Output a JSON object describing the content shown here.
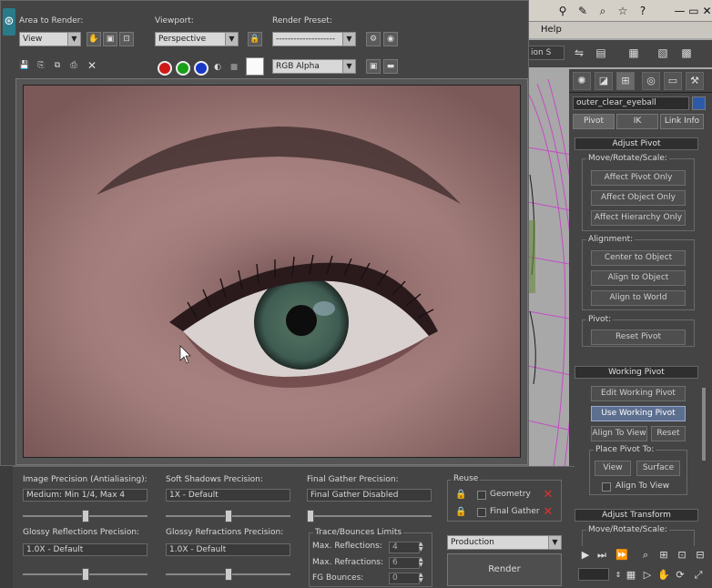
{
  "menu": {
    "help": "Help"
  },
  "right_toolbar": {
    "field": "ion S"
  },
  "command_panel": {
    "object_name": "outer_clear_eyeball",
    "color_swatch": "#2d5aa8",
    "subtabs": [
      "Pivot",
      "IK",
      "Link Info"
    ],
    "adjust_pivot": {
      "title": "Adjust Pivot",
      "move_rotate_scale": "Move/Rotate/Scale:",
      "buttons": [
        "Affect Pivot Only",
        "Affect Object Only",
        "Affect Hierarchy Only"
      ],
      "alignment": "Alignment:",
      "align_buttons": [
        "Center to Object",
        "Align to Object",
        "Align to World"
      ],
      "pivot": "Pivot:",
      "reset": "Reset Pivot"
    },
    "working_pivot": {
      "title": "Working Pivot",
      "edit": "Edit Working Pivot",
      "use": "Use Working Pivot",
      "align_to_view": "Align To View",
      "reset": "Reset",
      "place_pivot_to": "Place Pivot To:",
      "view": "View",
      "surface": "Surface",
      "align_to_view_cb": "Align To View"
    },
    "adjust_transform": {
      "title": "Adjust Transform",
      "move_rotate_scale": "Move/Rotate/Scale:"
    }
  },
  "render_frame": {
    "area_to_render_label": "Area to Render:",
    "area_to_render_value": "View",
    "viewport_label": "Viewport:",
    "viewport_value": "Perspective",
    "render_preset_label": "Render Preset:",
    "render_preset_value": "--------------------",
    "channel_value": "RGB Alpha",
    "channel_colors": [
      "#d01818",
      "#18a018",
      "#1838c8"
    ]
  },
  "settings": {
    "image_precision_label": "Image Precision (Antialiasing):",
    "image_precision_value": "Medium: Min 1/4, Max 4",
    "image_precision_slider": 0.5,
    "soft_shadows_label": "Soft Shadows Precision:",
    "soft_shadows_value": "1X - Default",
    "soft_shadows_slider": 0.5,
    "final_gather_label": "Final Gather Precision:",
    "final_gather_value": "Final Gather Disabled",
    "final_gather_slider": 0.0,
    "glossy_reflections_label": "Glossy Reflections Precision:",
    "glossy_reflections_value": "1.0X - Default",
    "glossy_reflections_slider": 0.5,
    "glossy_refractions_label": "Glossy Refractions Precision:",
    "glossy_refractions_value": "1.0X - Default",
    "glossy_refractions_slider": 0.5,
    "reuse_label": "Reuse",
    "reuse_geometry": "Geometry",
    "reuse_final_gather": "Final Gather",
    "trace_label": "Trace/Bounces Limits",
    "max_reflections_label": "Max. Reflections:",
    "max_reflections_value": "4",
    "max_refractions_label": "Max. Refractions:",
    "max_refractions_value": "6",
    "fg_bounces_label": "FG Bounces:",
    "fg_bounces_value": "0",
    "production_value": "Production",
    "render_button": "Render"
  }
}
